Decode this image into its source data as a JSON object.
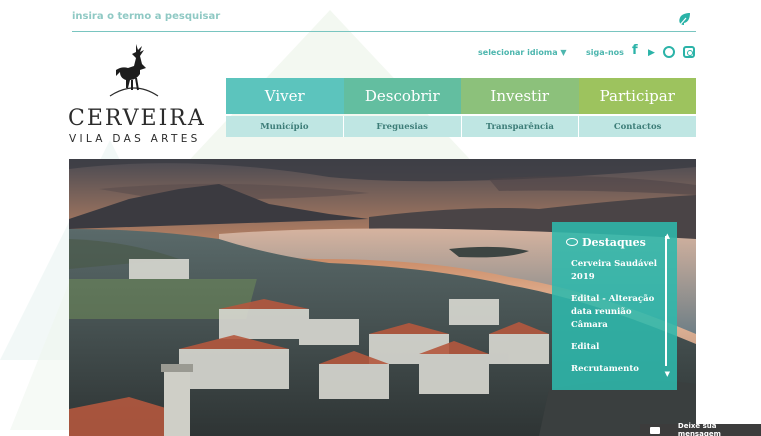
{
  "search": {
    "placeholder": "insira o termo a pesquisar"
  },
  "logo": {
    "name": "CERVEIRA",
    "subtitle": "VILA DAS ARTES"
  },
  "language": {
    "label": "selecionar idioma ▼"
  },
  "social": {
    "label": "siga-nos",
    "icons": [
      "facebook-icon",
      "youtube-icon",
      "instagram-icon",
      "instagram-icon"
    ]
  },
  "nav": {
    "main": [
      {
        "label": "Viver",
        "color": "#5cc4bd"
      },
      {
        "label": "Descobrir",
        "color": "#63bea0"
      },
      {
        "label": "Investir",
        "color": "#8cc17b"
      },
      {
        "label": "Participar",
        "color": "#9dc35e"
      }
    ],
    "sub": [
      {
        "label": "Município"
      },
      {
        "label": "Freguesias"
      },
      {
        "label": "Transparência"
      },
      {
        "label": "Contactos"
      }
    ]
  },
  "highlights": {
    "title": "Destaques",
    "items": [
      {
        "label": "Cerveira Saudável 2019"
      },
      {
        "label": "Edital - Alteração data reunião Câmara"
      },
      {
        "label": "Edital"
      },
      {
        "label": "Recrutamento"
      }
    ]
  },
  "chat": {
    "label": "Deixe sua mensagem"
  },
  "colors": {
    "accent": "#4db6ae",
    "panel": "#2db8ac"
  }
}
